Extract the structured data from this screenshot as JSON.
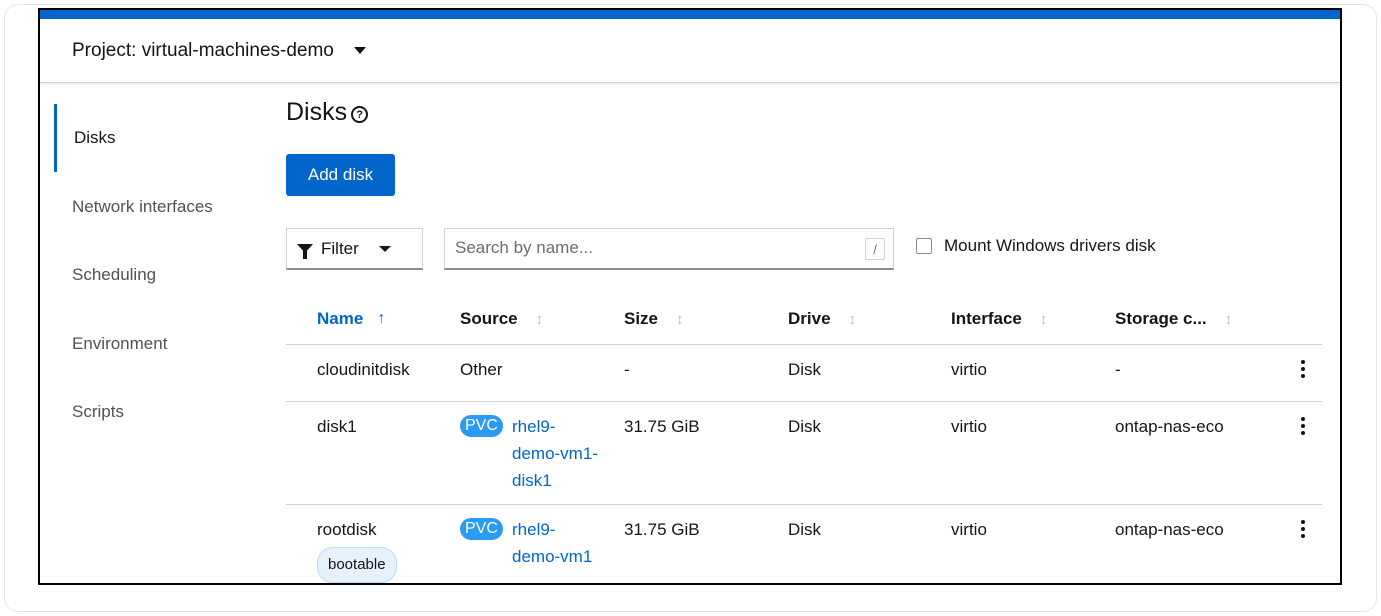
{
  "project": {
    "label": "Project: virtual-machines-demo"
  },
  "sidebar": {
    "items": [
      {
        "label": "Disks",
        "active": true
      },
      {
        "label": "Network interfaces",
        "active": false
      },
      {
        "label": "Scheduling",
        "active": false
      },
      {
        "label": "Environment",
        "active": false
      },
      {
        "label": "Scripts",
        "active": false
      }
    ]
  },
  "main": {
    "title": "Disks",
    "help_icon": "?",
    "add_button": "Add disk",
    "filter_label": "Filter",
    "search_placeholder": "Search by name...",
    "search_hint": "/",
    "checkbox_label": "Mount Windows drivers disk",
    "checkbox_checked": false
  },
  "table": {
    "columns": [
      "Name",
      "Source",
      "Size",
      "Drive",
      "Interface",
      "Storage c..."
    ],
    "sorted_column": "Name",
    "rows": [
      {
        "name": "cloudinitdisk",
        "badge": "",
        "source_type": "",
        "source": "Other",
        "size": "-",
        "drive": "Disk",
        "interface": "virtio",
        "storage": "-"
      },
      {
        "name": "disk1",
        "badge": "",
        "source_type": "PVC",
        "source": "rhel9-demo-vm1-disk1",
        "size": "31.75 GiB",
        "drive": "Disk",
        "interface": "virtio",
        "storage": "ontap-nas-eco"
      },
      {
        "name": "rootdisk",
        "badge": "bootable",
        "source_type": "PVC",
        "source": "rhel9-demo-vm1",
        "size": "31.75 GiB",
        "drive": "Disk",
        "interface": "virtio",
        "storage": "ontap-nas-eco"
      }
    ]
  },
  "colors": {
    "accent": "#0066cc",
    "pvc_badge": "#2b9af3",
    "border": "#d2d2d2"
  },
  "icons": {
    "project_dropdown": "caret-down-icon",
    "filter": "filter-icon",
    "kebab": "kebab-icon",
    "help": "help-circle-icon"
  }
}
